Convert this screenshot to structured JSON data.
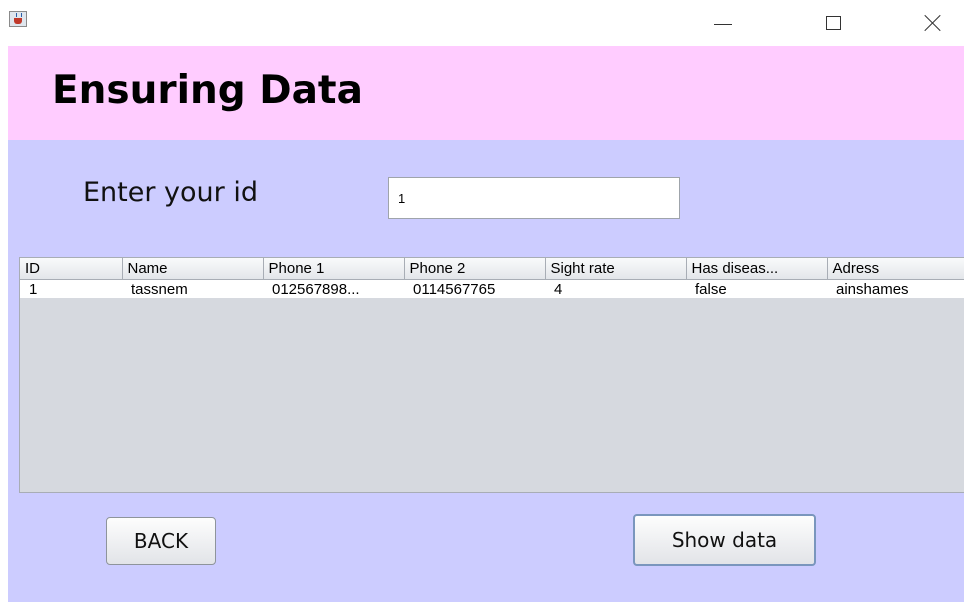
{
  "window": {
    "icon": "java-cup-icon",
    "controls": {
      "minimize": "minimize-icon",
      "maximize": "maximize-icon",
      "close": "close-icon"
    }
  },
  "header": {
    "title": "Ensuring Data",
    "background": "#ffccff"
  },
  "form": {
    "id_label": "Enter your id",
    "id_value": "1",
    "background": "#ccccff"
  },
  "table": {
    "columns": [
      "ID",
      "Name",
      "Phone 1",
      "Phone 2",
      "Sight rate",
      "Has diseas...",
      "Adress"
    ],
    "rows": [
      [
        "1",
        "tassnem",
        "012567898...",
        "0114567765",
        "4",
        "false",
        "ainshames"
      ]
    ]
  },
  "buttons": {
    "back_label": "BACK",
    "show_label": "Show data"
  }
}
